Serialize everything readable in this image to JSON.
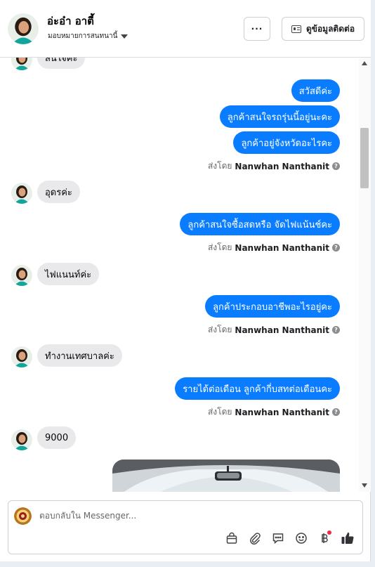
{
  "header": {
    "contact_name": "อ่ะอ๋า อาตี้",
    "assign_label": "มอบหมายการสนทนานี้",
    "more_label": "···",
    "view_contact_label": "ดูข้อมูลติดต่อ"
  },
  "chat": {
    "partial_incoming": "สนใจค่ะ",
    "sender_prefix": "ส่งโดย",
    "sender_name": "Nanwhan Nanthanit",
    "messages": [
      {
        "dir": "out",
        "text": "สวัสดีค่ะ"
      },
      {
        "dir": "out",
        "text": "ลูกค้าสนใจรถรุ่นนี้อยู่นะคะ"
      },
      {
        "dir": "out",
        "text": "ลูกค้าอยู่จังหวัดอะไรคะ"
      },
      {
        "dir": "in",
        "text": "อุดรค่ะ"
      },
      {
        "dir": "out",
        "text": "ลูกค้าสนใจซื้อสดหรือ จัดไฟแน้นช์คะ"
      },
      {
        "dir": "in",
        "text": "ไฟแนนท์ค่ะ"
      },
      {
        "dir": "out",
        "text": "ลูกค้าประกอบอาชีพอะไรอยู่คะ"
      },
      {
        "dir": "in",
        "text": "ทำงานเทศบาลค่ะ"
      },
      {
        "dir": "out",
        "text": "รายได้ต่อเดือน ลูกค้ากี่บสทต่อเดือนคะ"
      },
      {
        "dir": "in",
        "text": "9000"
      }
    ]
  },
  "composer": {
    "placeholder": "ตอบกลับใน Messenger..."
  },
  "icons": [
    "chevron-down-icon",
    "contact-card-icon",
    "bag-icon",
    "paperclip-icon",
    "saved-reply-icon",
    "emoji-icon",
    "baht-icon",
    "thumbs-up-icon"
  ],
  "colors": {
    "outgoing_bubble": "#0a7cff",
    "incoming_bubble": "#e9e9eb",
    "notification_dot": "#f02849"
  }
}
